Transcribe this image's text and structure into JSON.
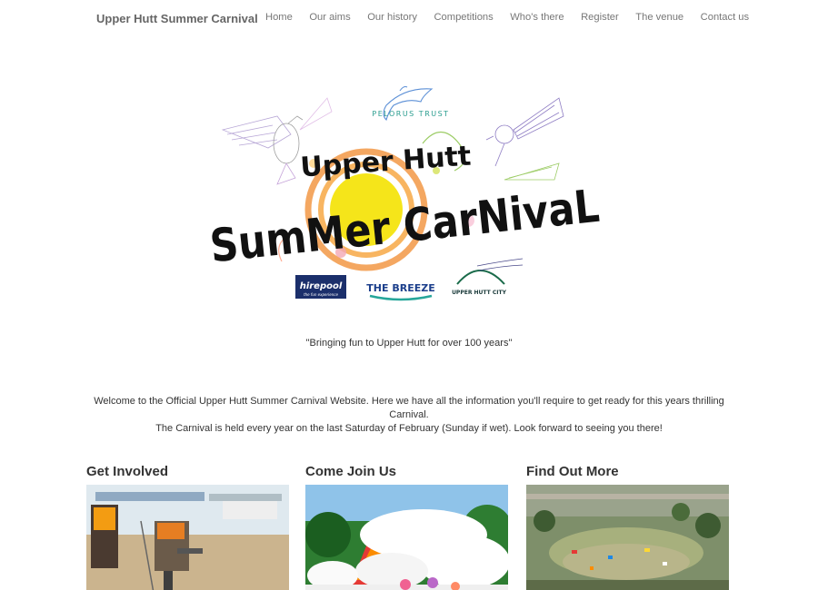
{
  "nav": {
    "brand": "Upper Hutt Summer Carnival",
    "items": [
      "Home",
      "Our aims",
      "Our history",
      "Competitions",
      "Who's there",
      "Register",
      "The venue",
      "Contact us"
    ]
  },
  "logo": {
    "trust": "PELORUS TRUST",
    "line1": "Upper Hutt",
    "line2": "SumMer CarNivaL",
    "sponsors": [
      "hirepool",
      "the fun experience",
      "THE BREEZE",
      "UPPER HUTT CITY"
    ]
  },
  "tagline": "\"Bringing fun to Upper Hutt for over 100 years\"",
  "welcome": {
    "line1": "Welcome to the Official Upper Hutt Summer Carnival Website. Here we have all the information you'll require to get ready for this years thrilling Carnival.",
    "line2": "The Carnival is held every year on the last Saturday of February (Sunday if wet). Look forward to seeing you there!"
  },
  "cards": [
    {
      "title": "Get Involved"
    },
    {
      "title": "Come Join Us"
    },
    {
      "title": "Find Out More"
    }
  ],
  "colors": {
    "nav_text": "#777777",
    "brand_text": "#666666",
    "body_text": "#333333",
    "sun_core": "#f5e51a",
    "sun_ring": "#f08a2c"
  }
}
